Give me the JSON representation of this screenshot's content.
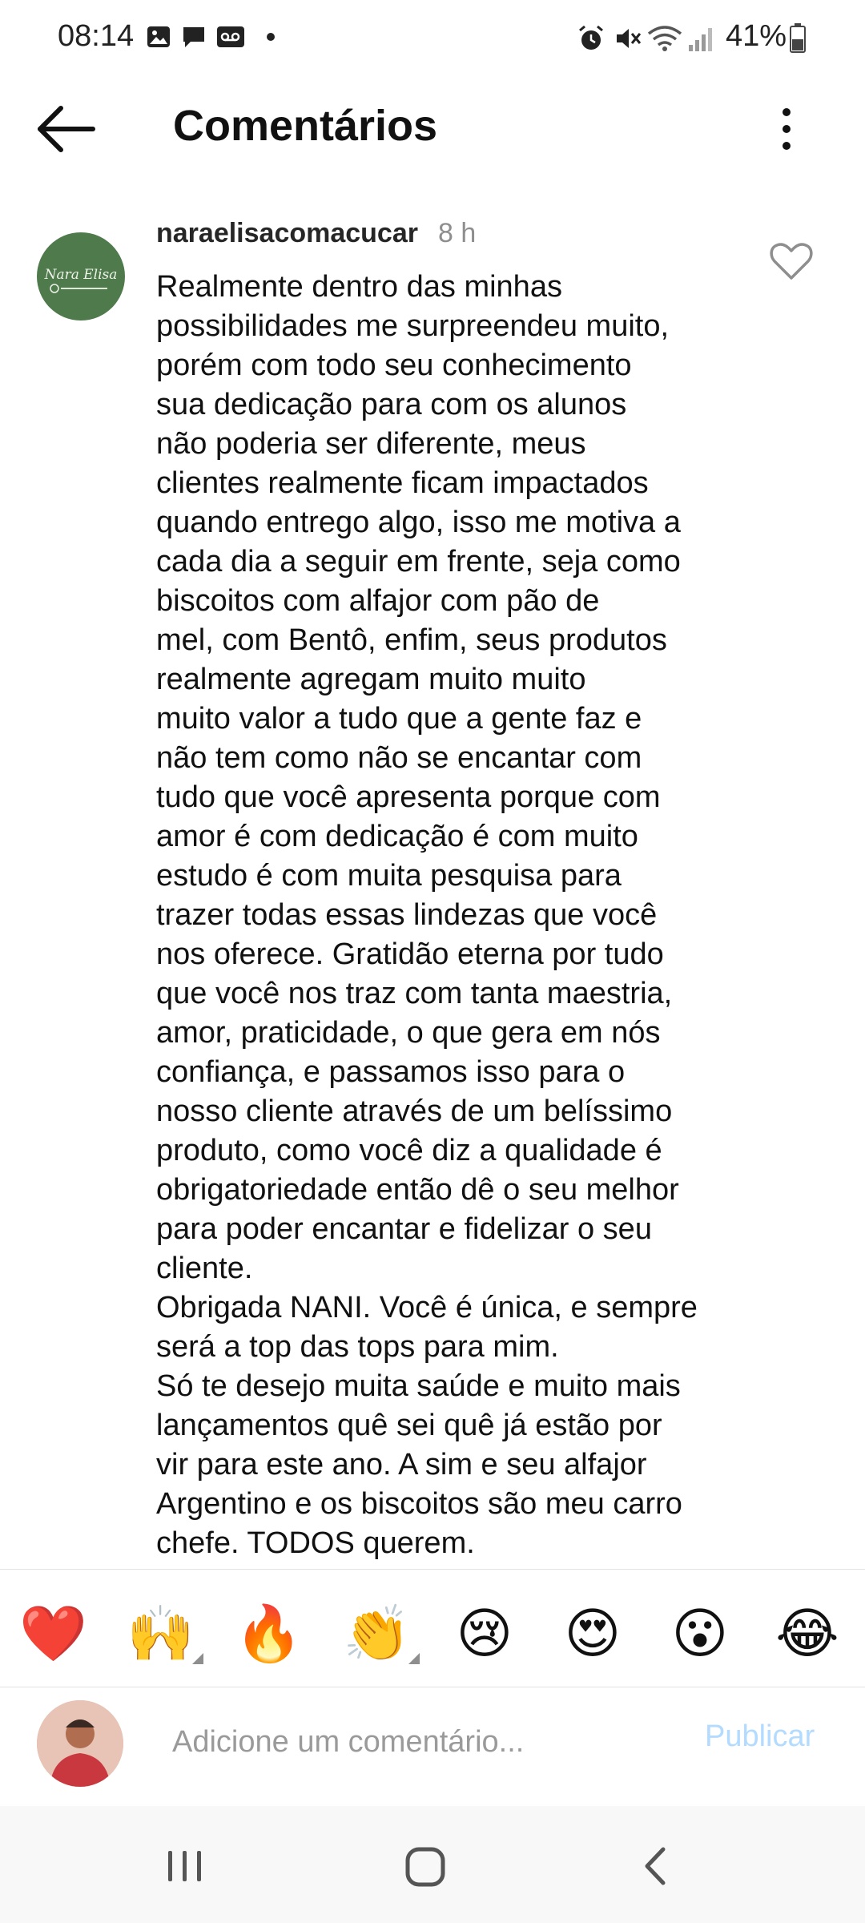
{
  "status_bar": {
    "time": "08:14",
    "battery": "41%",
    "left_icons": [
      "image-icon",
      "message-icon",
      "voicemail-icon",
      "dot-icon"
    ],
    "right_icons": [
      "alarm-icon",
      "mute-icon",
      "wifi-icon",
      "signal-icon",
      "battery-icon"
    ]
  },
  "header": {
    "title": "Comentários",
    "back_icon": "arrow-left-icon",
    "more_icon": "more-vertical-icon"
  },
  "comment": {
    "username": "naraelisacomacucar",
    "time": "8 h",
    "avatar_text": "Nara Elisa",
    "text": "Realmente dentro das minhas\npossibilidades me surpreendeu muito,\nporém com todo seu conhecimento\nsua dedicação para com os alunos\nnão poderia ser diferente, meus\nclientes realmente ficam impactados\nquando entrego algo, isso me motiva a\ncada dia a seguir em frente, seja como\nbiscoitos com alfajor com pão de\nmel, com Bentô, enfim, seus produtos\nrealmente agregam muito muito\nmuito valor a tudo que a gente faz e\nnão tem como não se encantar com\ntudo que você apresenta porque com\namor é com dedicação é com muito\nestudo é com muita pesquisa para\ntrazer todas essas lindezas que você\nnos oferece. Gratidão eterna por tudo\nque você nos traz com tanta maestria,\namor, praticidade, o que gera em nós\nconfiança, e passamos isso para o\nnosso cliente através de um belíssimo\nproduto, como você diz a qualidade é\nobrigatoriedade então dê o seu melhor\npara poder encantar e fidelizar o seu\ncliente.\nObrigada NANI. Você é única, e sempre\nserá a top das tops para mim.\nSó te desejo muita saúde e muito mais\nlançamentos quê sei quê já estão por\nvir para este ano. A sim e seu alfajor\nArgentino e os biscoitos são meu carro\nchefe. TODOS querem.",
    "like_icon": "heart-outline-icon"
  },
  "reactions": [
    {
      "emoji": "❤️",
      "name": "heart"
    },
    {
      "emoji": "🙌",
      "name": "raising-hands"
    },
    {
      "emoji": "🔥",
      "name": "fire"
    },
    {
      "emoji": "👏",
      "name": "clapping-hands"
    },
    {
      "emoji": "😢",
      "name": "crying-face"
    },
    {
      "emoji": "😍",
      "name": "heart-eyes"
    },
    {
      "emoji": "😮",
      "name": "surprised-face"
    },
    {
      "emoji": "😂",
      "name": "tears-of-joy"
    }
  ],
  "add_comment": {
    "placeholder": "Adicione um comentário...",
    "publish_label": "Publicar"
  },
  "colors": {
    "accent_disabled": "#b3dbff",
    "avatar_green": "#4f7a4c",
    "muted_text": "#8e8e8e"
  }
}
